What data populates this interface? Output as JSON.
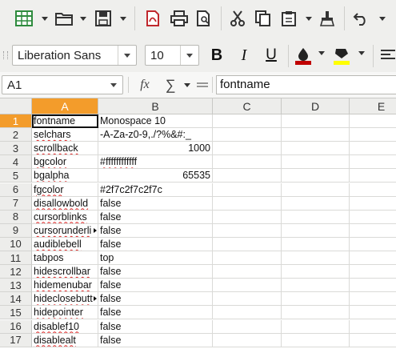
{
  "toolbar": {
    "font_name": "Liberation Sans",
    "font_size": "10",
    "bold_label": "B",
    "italic_label": "I",
    "underline_label": "U",
    "font_color": "#c00000",
    "highlight_color": "#ffff00"
  },
  "formula_bar": {
    "name_box": "A1",
    "fx_label": "fx",
    "sum_label": "∑",
    "content": "fontname"
  },
  "columns": [
    "A",
    "B",
    "C",
    "D",
    "E"
  ],
  "selected_column": "A",
  "selected_row": 1,
  "rows": [
    {
      "num": "1",
      "a": "fontname",
      "b": "Monospace 10"
    },
    {
      "num": "2",
      "a": "selchars",
      "b": "-A-Za-z0-9,./?%&#:_"
    },
    {
      "num": "3",
      "a": "scrollback",
      "b": "1000"
    },
    {
      "num": "4",
      "a": "bgcolor",
      "b": "#ffffffffffff"
    },
    {
      "num": "5",
      "a": "bgalpha",
      "b": "65535"
    },
    {
      "num": "6",
      "a": "fgcolor",
      "b": "#2f7c2f7c2f7c"
    },
    {
      "num": "7",
      "a": "disallowbold",
      "b": "false"
    },
    {
      "num": "8",
      "a": "cursorblinks",
      "b": "false"
    },
    {
      "num": "9",
      "a": "cursorunderli",
      "b": "false"
    },
    {
      "num": "10",
      "a": "audiblebell",
      "b": "false"
    },
    {
      "num": "11",
      "a": "tabpos",
      "b": "top"
    },
    {
      "num": "12",
      "a": "hidescrollbar",
      "b": "false"
    },
    {
      "num": "13",
      "a": "hidemenubar",
      "b": "false"
    },
    {
      "num": "14",
      "a": "hideclosebutt",
      "b": "false"
    },
    {
      "num": "15",
      "a": "hidepointer",
      "b": "false"
    },
    {
      "num": "16",
      "a": "disablef10",
      "b": "false"
    },
    {
      "num": "17",
      "a": "disablealt",
      "b": "false"
    }
  ]
}
